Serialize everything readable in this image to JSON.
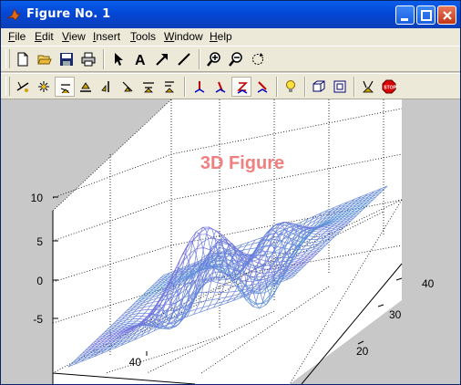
{
  "window": {
    "title": "Figure No. 1",
    "title_color": "#ffffff",
    "titlebar_color": "#0346d6"
  },
  "menubar": {
    "items": [
      {
        "label": "File",
        "mnemonic": "F"
      },
      {
        "label": "Edit",
        "mnemonic": "E"
      },
      {
        "label": "View",
        "mnemonic": "V"
      },
      {
        "label": "Insert",
        "mnemonic": "I"
      },
      {
        "label": "Tools",
        "mnemonic": "T"
      },
      {
        "label": "Window",
        "mnemonic": "W"
      },
      {
        "label": "Help",
        "mnemonic": "H"
      }
    ]
  },
  "toolbar1": {
    "icons": [
      "new-file-icon",
      "open-folder-icon",
      "save-icon",
      "print-icon",
      "edit-plot-arrow-icon",
      "insert-text-icon",
      "insert-arrow-icon",
      "insert-line-icon",
      "zoom-in-icon",
      "zoom-out-icon",
      "rotate-3d-icon"
    ]
  },
  "toolbar2": {
    "icons": [
      "camera-orbit-icon",
      "camera-orbit-scene-light-icon",
      "camera-pan-tilt-icon",
      "camera-move-horizontal-icon",
      "camera-move-vertical-icon",
      "camera-move-forward-back-icon",
      "camera-zoom-icon",
      "camera-roll-icon",
      "principal-axis-x-icon",
      "principal-axis-y-icon",
      "principal-axis-z-icon",
      "principal-axis-none-icon",
      "toggle-scene-light-icon",
      "orthographic-projection-icon",
      "perspective-projection-icon",
      "reset-camera-icon",
      "stop-camera-motion-icon"
    ],
    "pressed": "camera-pan-tilt-icon"
  },
  "figure": {
    "background": "#c8c8c8",
    "axes_background": "#ffffff",
    "title": "3D Figure",
    "title_color": "#f08080",
    "z_ticks": [
      "10",
      "5",
      "0",
      "-5"
    ],
    "x_ticks": [
      "40"
    ],
    "y_ticks": [
      "20",
      "30",
      "40"
    ]
  }
}
